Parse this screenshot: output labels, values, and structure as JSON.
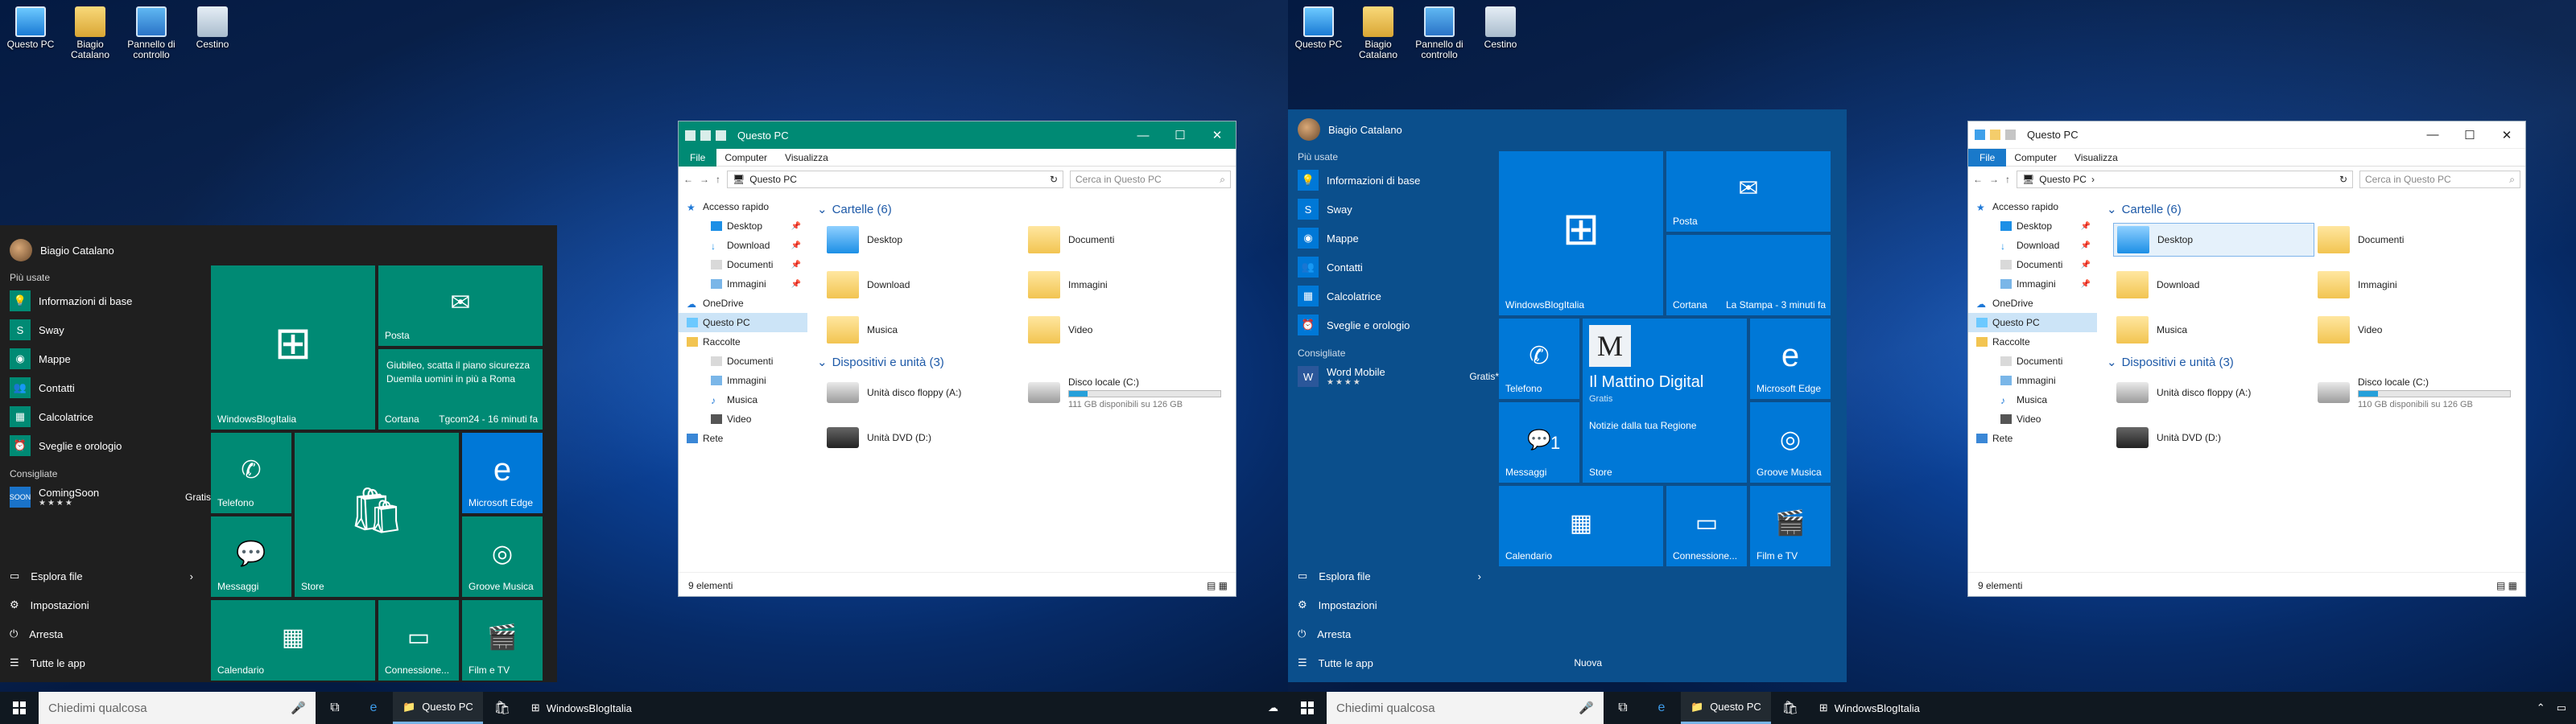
{
  "desktop_icons": [
    {
      "label": "Questo PC",
      "icon": "this-pc-icon"
    },
    {
      "label": "Biagio Catalano",
      "icon": "user-folder-icon"
    },
    {
      "label": "Pannello di controllo",
      "icon": "control-panel-icon"
    },
    {
      "label": "Cestino",
      "icon": "recycle-bin-icon"
    }
  ],
  "start": {
    "user": "Biagio Catalano",
    "most_used_label": "Più usate",
    "apps": [
      "Informazioni di base",
      "Sway",
      "Mappe",
      "Contatti",
      "Calcolatrice",
      "Sveglie e orologio"
    ],
    "suggested_label": "Consigliate",
    "left_suggested": {
      "name": "ComingSoon",
      "price": "Gratis",
      "stars": "★★★★"
    },
    "right_suggested": {
      "name": "Word Mobile",
      "price": "Gratis*",
      "stars": "★★★★"
    },
    "bottom": [
      "Esplora file",
      "Impostazioni",
      "Arresta",
      "Tutte le app"
    ],
    "new_label": "Nuova"
  },
  "tiles": {
    "wbi": "WindowsBlogItalia",
    "posta": "Posta",
    "posta_msg": "Giubileo, scatta il piano sicurezza Duemila uomini in più a Roma",
    "cortana": "Cortana",
    "tgcom": "Tgcom24 - 16 minuti fa",
    "lastampa": "La Stampa - 3 minuti fa",
    "telefono": "Telefono",
    "store": "Store",
    "edge": "Microsoft Edge",
    "messaggi": "Messaggi",
    "messaggi_count": "1",
    "groove": "Groove Musica",
    "calendario": "Calendario",
    "connessione": "Connessione...",
    "filmtv": "Film e TV",
    "mattino_title": "Il Mattino Digital",
    "mattino_price": "Gratis",
    "mattino_news": "Notizie dalla tua Regione"
  },
  "explorer": {
    "title": "Questo PC",
    "tabs": [
      "File",
      "Computer",
      "Visualizza"
    ],
    "address": "Questo PC",
    "search_placeholder": "Cerca in Questo PC",
    "nav": {
      "quick": "Accesso rapido",
      "quick_items": [
        "Desktop",
        "Download",
        "Documenti",
        "Immagini"
      ],
      "onedrive": "OneDrive",
      "thispc": "Questo PC",
      "libs": "Raccolte",
      "lib_items": [
        "Documenti",
        "Immagini",
        "Musica",
        "Video"
      ],
      "network": "Rete"
    },
    "folders_header": "Cartelle (6)",
    "folders": [
      "Desktop",
      "Documenti",
      "Download",
      "Immagini",
      "Musica",
      "Video"
    ],
    "devices_header": "Dispositivi e unità (3)",
    "floppy": "Unità disco floppy (A:)",
    "dvd": "Unità DVD (D:)",
    "disk": "Disco locale (C:)",
    "disk_left_free": "111 GB disponibili su 126 GB",
    "disk_right_free": "110 GB disponibili su 126 GB",
    "disk_left_used": 0.12,
    "disk_right_used": 0.13,
    "status": "9 elementi"
  },
  "taskbar": {
    "search": "Chiedimi qualcosa",
    "explorer_app": "Questo PC",
    "wbi_app": "WindowsBlogItalia"
  },
  "colors": {
    "left_accent": "#008a74",
    "left_start_bg": "#1f1f1f",
    "right_accent": "#0078d7",
    "right_start_bg": "#0b4f8c",
    "right_title": "#ffffff"
  }
}
